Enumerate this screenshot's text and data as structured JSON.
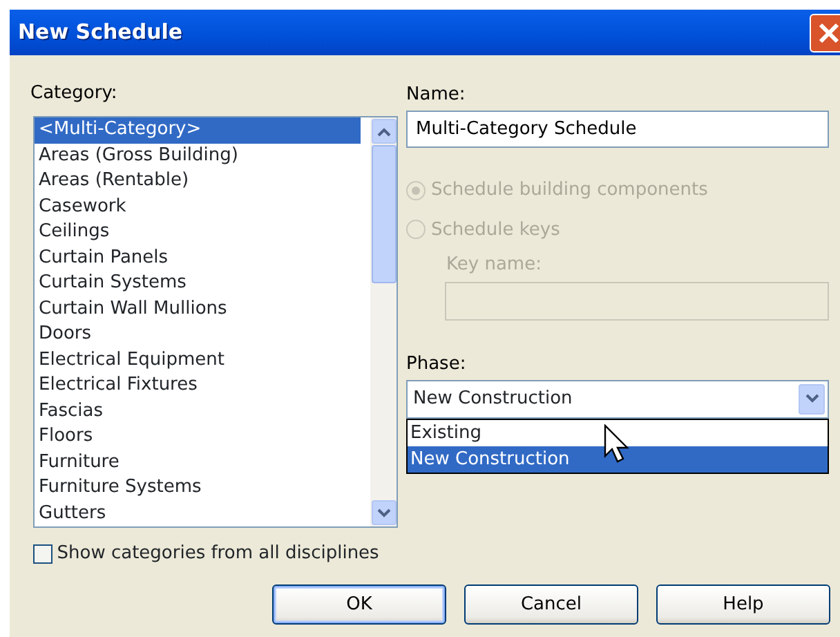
{
  "window": {
    "title": "New Schedule"
  },
  "category": {
    "label": "Category:",
    "items": [
      {
        "label": "<Multi-Category>",
        "selected": true
      },
      {
        "label": "Areas (Gross Building)",
        "selected": false
      },
      {
        "label": "Areas (Rentable)",
        "selected": false
      },
      {
        "label": "Casework",
        "selected": false
      },
      {
        "label": "Ceilings",
        "selected": false
      },
      {
        "label": "Curtain Panels",
        "selected": false
      },
      {
        "label": "Curtain Systems",
        "selected": false
      },
      {
        "label": "Curtain Wall Mullions",
        "selected": false
      },
      {
        "label": "Doors",
        "selected": false
      },
      {
        "label": "Electrical Equipment",
        "selected": false
      },
      {
        "label": "Electrical Fixtures",
        "selected": false
      },
      {
        "label": "Fascias",
        "selected": false
      },
      {
        "label": "Floors",
        "selected": false
      },
      {
        "label": "Furniture",
        "selected": false
      },
      {
        "label": "Furniture Systems",
        "selected": false
      },
      {
        "label": "Gutters",
        "selected": false
      }
    ]
  },
  "show_all": {
    "label": "Show categories from all disciplines",
    "checked": false
  },
  "name": {
    "label": "Name:",
    "value": "Multi-Category Schedule"
  },
  "schedule_type": [
    {
      "label": "Schedule building components",
      "selected": true,
      "disabled": true
    },
    {
      "label": "Schedule keys",
      "selected": false,
      "disabled": true
    }
  ],
  "key_name": {
    "label": "Key name:",
    "disabled": true
  },
  "phase": {
    "label": "Phase:",
    "value": "New Construction",
    "expanded": true,
    "options": [
      {
        "label": "Existing",
        "selected": false
      },
      {
        "label": "New Construction",
        "selected": true
      }
    ]
  },
  "buttons": [
    {
      "label": "OK",
      "default": true
    },
    {
      "label": "Cancel",
      "default": false
    },
    {
      "label": "Help",
      "default": false
    }
  ]
}
